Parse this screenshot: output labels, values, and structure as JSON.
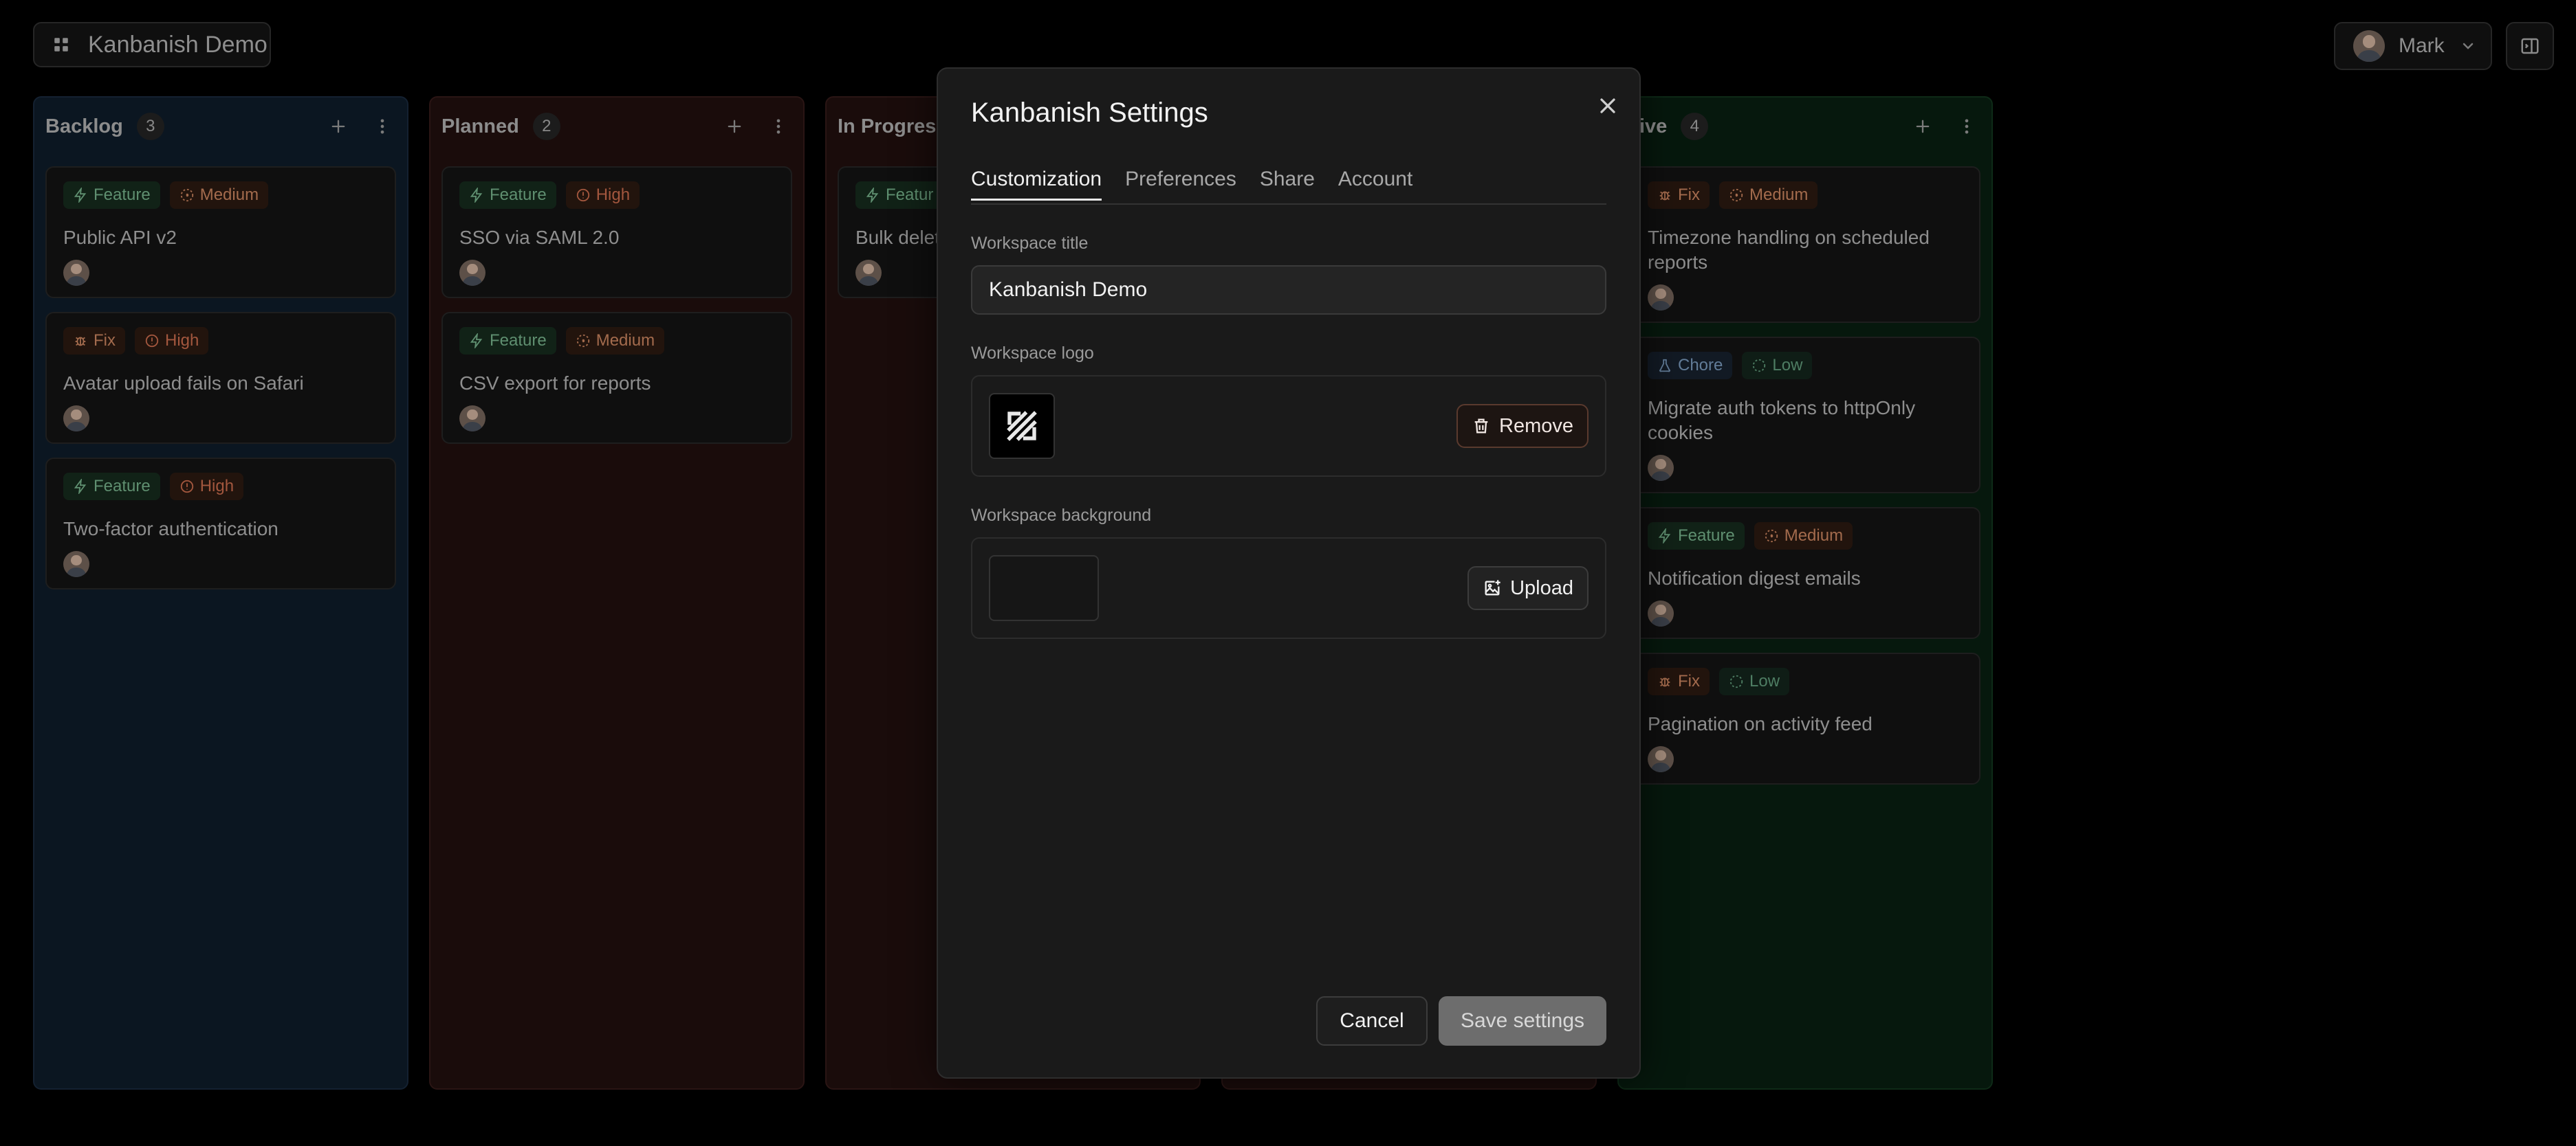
{
  "topbar": {
    "workspace_title": "Kanbanish Demo",
    "user_name": "Mark"
  },
  "columns": [
    {
      "title": "Backlog",
      "count": "3",
      "color": "#0b1621",
      "cards": [
        {
          "type": "Feature",
          "priority": "Medium",
          "title": "Public API v2"
        },
        {
          "type": "Fix",
          "priority": "High",
          "title": "Avatar upload fails on Safari"
        },
        {
          "type": "Feature",
          "priority": "High",
          "title": "Two-factor authentication"
        }
      ]
    },
    {
      "title": "Planned",
      "count": "2",
      "color": "#1a0c0b",
      "cards": [
        {
          "type": "Feature",
          "priority": "High",
          "title": "SSO via SAML 2.0"
        },
        {
          "type": "Feature",
          "priority": "Medium",
          "title": "CSV export for reports"
        }
      ]
    },
    {
      "title": "In Progress",
      "color": "#1a0c0b",
      "cards": [
        {
          "type": "Featur",
          "title": "Bulk delet"
        }
      ]
    },
    {
      "title": "ive",
      "count": "4",
      "color": "#06180d",
      "cards": [
        {
          "type": "Fix",
          "priority": "Medium",
          "title": "Timezone handling on scheduled reports"
        },
        {
          "type": "Chore",
          "priority": "Low",
          "title": "Migrate auth tokens to httpOnly cookies"
        },
        {
          "type": "Feature",
          "priority": "Medium",
          "title": "Notification digest emails"
        },
        {
          "type": "Fix",
          "priority": "Low",
          "title": "Pagination on activity feed"
        }
      ]
    }
  ],
  "modal": {
    "title": "Kanbanish Settings",
    "tabs": [
      "Customization",
      "Preferences",
      "Share",
      "Account"
    ],
    "active_tab": "Customization",
    "workspace_title_label": "Workspace title",
    "workspace_title_value": "Kanbanish Demo",
    "workspace_logo_label": "Workspace logo",
    "remove_label": "Remove",
    "workspace_background_label": "Workspace background",
    "upload_label": "Upload",
    "cancel_label": "Cancel",
    "save_label": "Save settings"
  },
  "icons": {
    "workspace": "grid-icon",
    "user_menu": "chevron-down-icon",
    "panel": "sidebar-panel-icon",
    "column_add": "plus-icon",
    "column_more": "more-vertical-icon",
    "feature": "zap-icon",
    "fix": "bug-icon",
    "chore": "flask-icon",
    "medium": "dashed-circle-icon",
    "high": "alert-circle-icon",
    "low": "dashed-circle-icon",
    "close": "close-icon",
    "remove": "trash-icon",
    "upload": "image-plus-icon"
  }
}
